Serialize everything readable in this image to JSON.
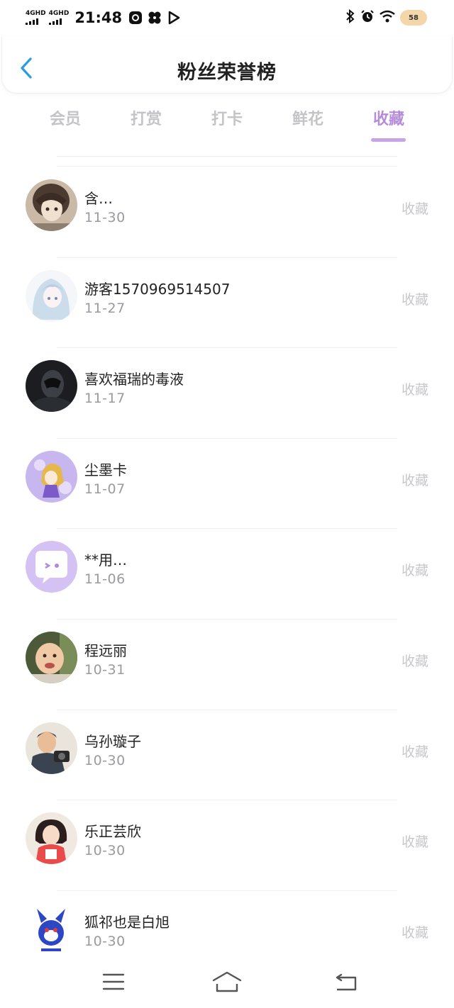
{
  "status_bar": {
    "signal1_label": "4GHD",
    "signal2_label": "4GHD",
    "time": "21:48",
    "battery": "58"
  },
  "header": {
    "title": "粉丝荣誉榜"
  },
  "tabs": [
    {
      "label": "会员",
      "active": false
    },
    {
      "label": "打赏",
      "active": false
    },
    {
      "label": "打卡",
      "active": false
    },
    {
      "label": "鲜花",
      "active": false
    },
    {
      "label": "收藏",
      "active": true
    }
  ],
  "fans": [
    {
      "name": "含…",
      "date": "11-30",
      "tag": "收藏"
    },
    {
      "name": "游客1570969514507",
      "date": "11-27",
      "tag": "收藏"
    },
    {
      "name": "喜欢福瑞的毒液",
      "date": "11-17",
      "tag": "收藏"
    },
    {
      "name": "尘墨卡",
      "date": "11-07",
      "tag": "收藏"
    },
    {
      "name": "**用…",
      "date": "11-06",
      "tag": "收藏"
    },
    {
      "name": "程远丽",
      "date": "10-31",
      "tag": "收藏"
    },
    {
      "name": "乌孙璇子",
      "date": "10-30",
      "tag": "收藏"
    },
    {
      "name": "乐正芸欣",
      "date": "10-30",
      "tag": "收藏"
    },
    {
      "name": "狐祁也是白旭",
      "date": "10-30",
      "tag": "收藏"
    }
  ],
  "colors": {
    "accent": "#b58bdb",
    "back_arrow": "#2a9be0",
    "muted_tag": "#c8c8cc"
  },
  "icons": {
    "back": "chevron-left-icon",
    "nav_menu": "menu-icon",
    "nav_home": "home-icon",
    "nav_back": "back-icon"
  }
}
